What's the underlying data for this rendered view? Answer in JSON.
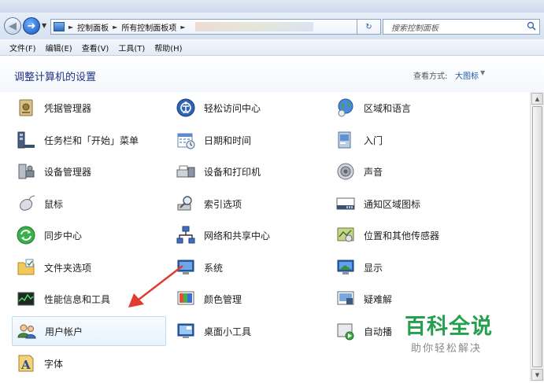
{
  "address_bar": {
    "crumbs": [
      "控制面板",
      "所有控制面板项"
    ],
    "search_placeholder": "搜索控制面板"
  },
  "menu": [
    "文件(F)",
    "编辑(E)",
    "查看(V)",
    "工具(T)",
    "帮助(H)"
  ],
  "header": {
    "title": "调整计算机的设置",
    "view_label": "查看方式:",
    "view_value": "大图标"
  },
  "columns": [
    [
      {
        "label": "凭据管理器",
        "icon": "credential-vault-icon"
      },
      {
        "label": "任务栏和「开始」菜单",
        "icon": "taskbar-icon"
      },
      {
        "label": "设备管理器",
        "icon": "device-manager-icon"
      },
      {
        "label": "鼠标",
        "icon": "mouse-icon"
      },
      {
        "label": "同步中心",
        "icon": "sync-center-icon"
      },
      {
        "label": "文件夹选项",
        "icon": "folder-options-icon"
      },
      {
        "label": "性能信息和工具",
        "icon": "performance-icon"
      },
      {
        "label": "用户帐户",
        "icon": "user-accounts-icon"
      },
      {
        "label": "字体",
        "icon": "fonts-icon"
      }
    ],
    [
      {
        "label": "轻松访问中心",
        "icon": "ease-of-access-icon"
      },
      {
        "label": "日期和时间",
        "icon": "date-time-icon"
      },
      {
        "label": "设备和打印机",
        "icon": "devices-printers-icon"
      },
      {
        "label": "索引选项",
        "icon": "indexing-icon"
      },
      {
        "label": "网络和共享中心",
        "icon": "network-icon"
      },
      {
        "label": "系统",
        "icon": "system-icon"
      },
      {
        "label": "颜色管理",
        "icon": "color-management-icon"
      },
      {
        "label": "桌面小工具",
        "icon": "gadgets-icon"
      }
    ],
    [
      {
        "label": "区域和语言",
        "icon": "region-language-icon"
      },
      {
        "label": "入门",
        "icon": "getting-started-icon"
      },
      {
        "label": "声音",
        "icon": "sound-icon"
      },
      {
        "label": "通知区域图标",
        "icon": "notification-area-icon"
      },
      {
        "label": "位置和其他传感器",
        "icon": "location-sensors-icon"
      },
      {
        "label": "显示",
        "icon": "display-icon"
      },
      {
        "label": "疑难解",
        "icon": "troubleshooting-icon"
      },
      {
        "label": "自动播",
        "icon": "autoplay-icon"
      }
    ]
  ],
  "selected_item": "用户帐户",
  "watermark": {
    "title": "百科全说",
    "subtitle": "助你轻松解决"
  },
  "colors": {
    "accent": "#1e3287",
    "arrow": "#e03c32",
    "watermark": "#25a04e"
  }
}
